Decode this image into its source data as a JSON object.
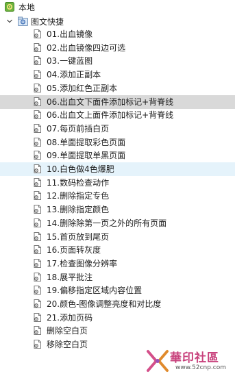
{
  "tree": {
    "root": {
      "label": "本地",
      "icon": "gear-folder-icon",
      "accent": "#5a9e2e"
    },
    "folder": {
      "label": "图文快捷",
      "expanded": true,
      "icon": "gear-folder-icon"
    },
    "items": [
      {
        "label": "01.出血镜像"
      },
      {
        "label": "02.出血镜像四边可选"
      },
      {
        "label": "03.一键蓝图"
      },
      {
        "label": "04.添加正副本"
      },
      {
        "label": "05.添加红色正副本"
      },
      {
        "label": "06.出血文下面件添加标记+背脊线",
        "state": "selected"
      },
      {
        "label": "06.出血文上面件添加标记+背脊线"
      },
      {
        "label": "07.每页前插白页"
      },
      {
        "label": "08.单面提取彩色页面"
      },
      {
        "label": "09.单面提取单黑页面"
      },
      {
        "label": "10.白色做4色爆肥",
        "state": "hover"
      },
      {
        "label": "11.数码检查动作"
      },
      {
        "label": "12.删除指定专色"
      },
      {
        "label": "13.删除指定颜色"
      },
      {
        "label": "14.删除除第一页之外的所有页面"
      },
      {
        "label": "15.首页放到尾页"
      },
      {
        "label": "16.页面转灰度"
      },
      {
        "label": "17.检查图像分辨率"
      },
      {
        "label": "18.展平批注"
      },
      {
        "label": "19.偏移指定区域内容位置"
      },
      {
        "label": "20.颜色-图像调整亮度和对比度"
      },
      {
        "label": "21.添加页码"
      },
      {
        "label": "删除空白页"
      },
      {
        "label": "移除空白页"
      }
    ]
  },
  "watermark": {
    "text": "華印社區",
    "url": "www.52cnp.com",
    "color": "#c8417c"
  }
}
